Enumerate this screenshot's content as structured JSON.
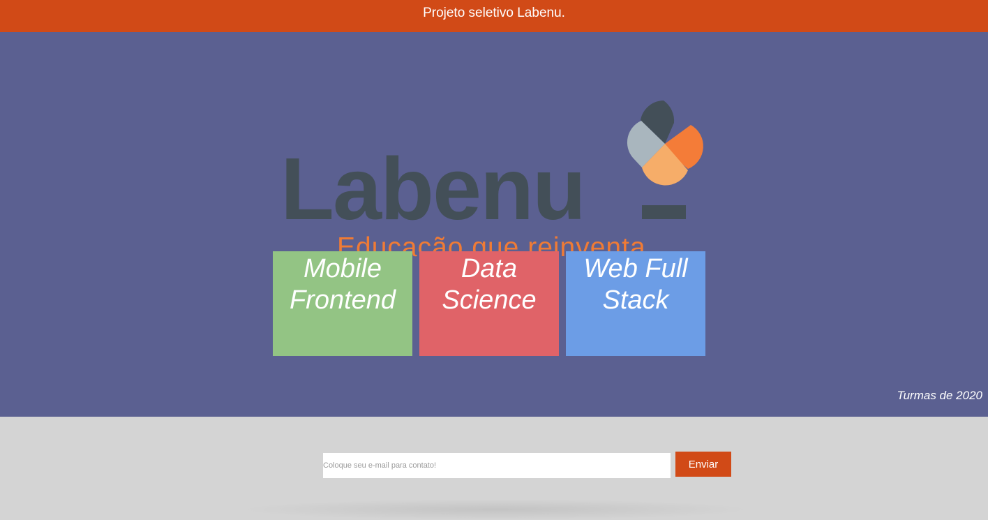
{
  "header": {
    "title": "Projeto seletivo Labenu."
  },
  "logo": {
    "wordmark": "Labenu",
    "tagline": "Educação que reinventa",
    "colors": {
      "wordmark": "#434f58",
      "tagline": "#f07b35",
      "petal_dark": "#434f58",
      "petal_gray": "#a9b6be",
      "petal_orange": "#f47c38",
      "petal_light_orange": "#f6ad69"
    }
  },
  "courses": [
    {
      "label": "Mobile Frontend",
      "color": "#93c484"
    },
    {
      "label": "Data Science",
      "color": "#e06368"
    },
    {
      "label": "Web Full Stack",
      "color": "#6c9de6"
    }
  ],
  "footnote": "Turmas de 2020",
  "contact": {
    "placeholder": "Coloque seu e-mail para contato!",
    "button_label": "Enviar"
  },
  "colors": {
    "header_bg": "#d14a17",
    "main_bg": "#5b6091",
    "contact_bg": "#d4d4d4"
  }
}
